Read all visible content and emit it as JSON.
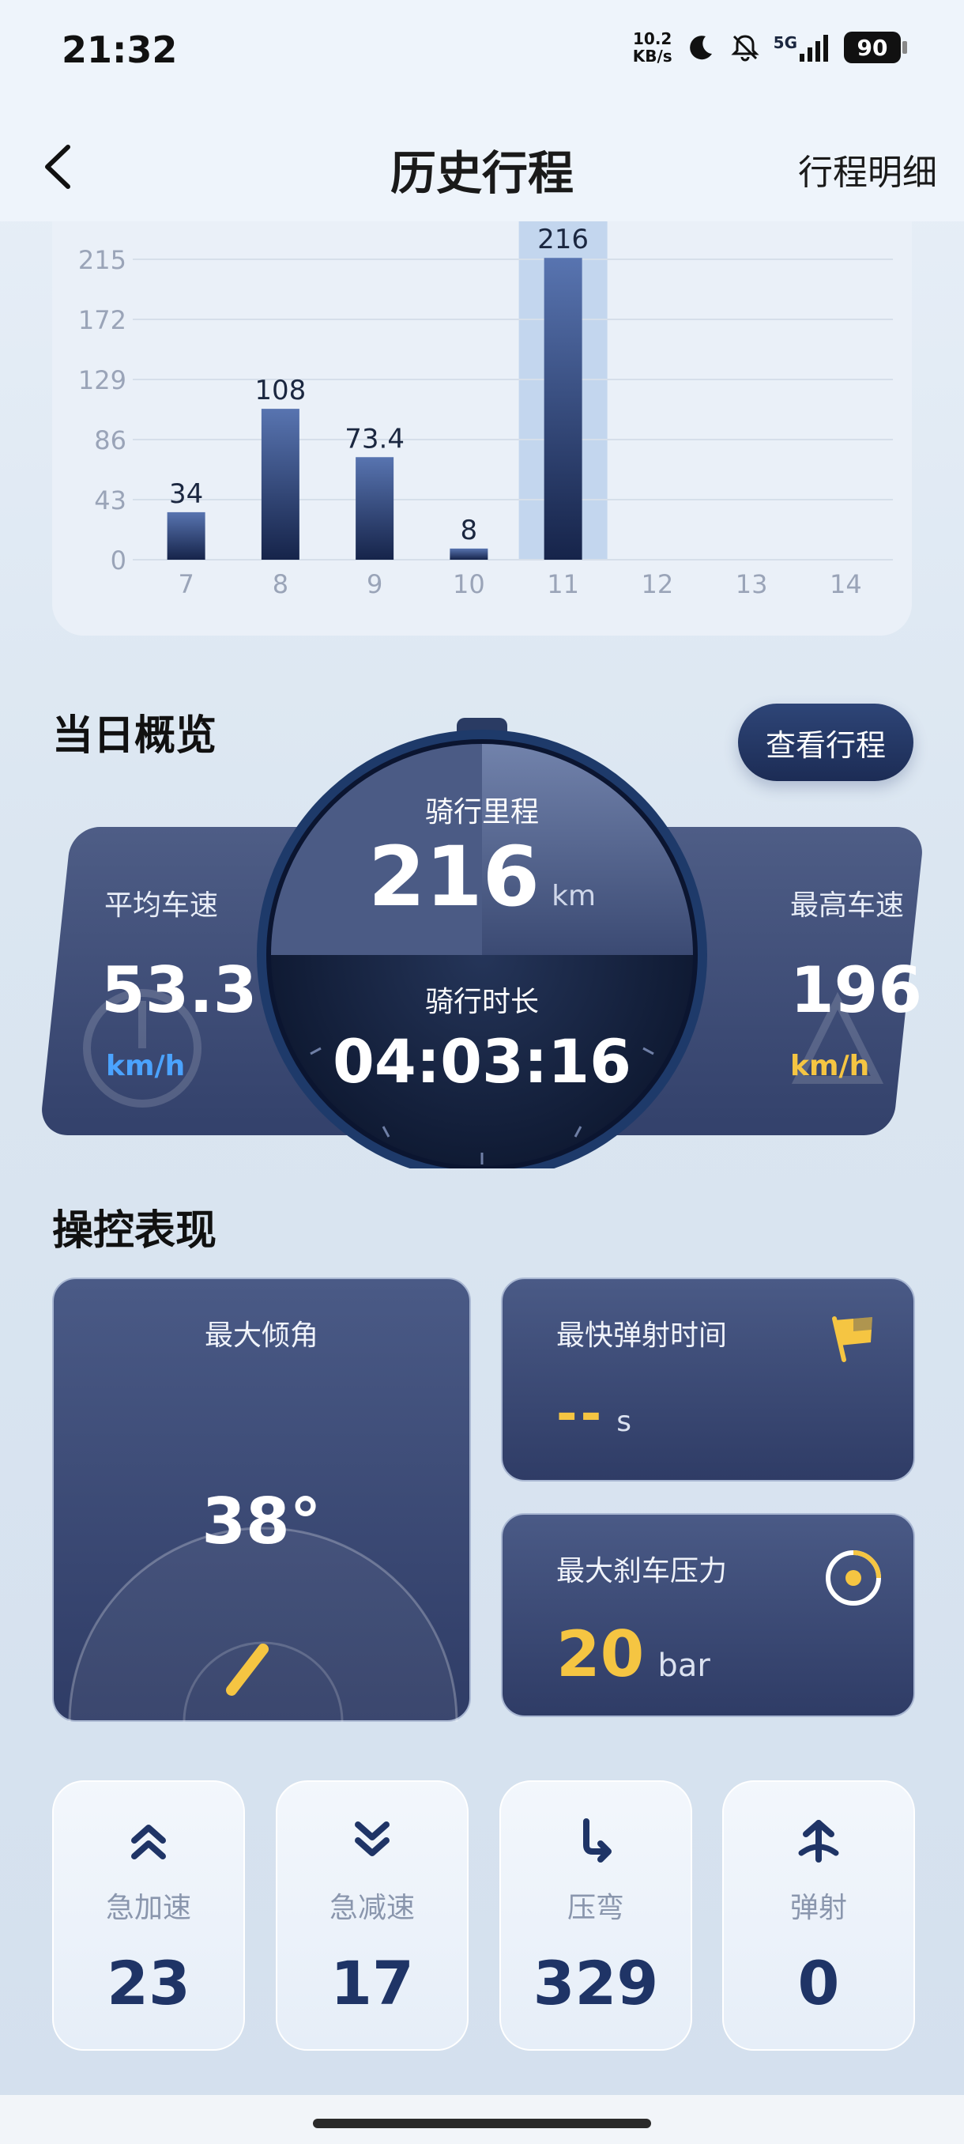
{
  "status_bar": {
    "time": "21:32",
    "net_speed_value": "10.2",
    "net_speed_unit": "KB/s",
    "signal_label": "5G",
    "battery": "90"
  },
  "nav": {
    "title": "历史行程",
    "action": "行程明细"
  },
  "chart_data": {
    "type": "bar",
    "categories": [
      "7",
      "8",
      "9",
      "10",
      "11",
      "12",
      "13",
      "14"
    ],
    "values": [
      34,
      108,
      73.4,
      8,
      216,
      null,
      null,
      null
    ],
    "value_labels": [
      "34",
      "108",
      "73.4",
      "8",
      "216",
      "",
      "",
      ""
    ],
    "yticks": [
      "0",
      "43",
      "86",
      "129",
      "172",
      "215"
    ],
    "ylim": [
      0,
      215
    ],
    "selected_index": 4,
    "grid": true
  },
  "overview": {
    "title": "当日概览",
    "view_button": "查看行程",
    "avg_speed_label": "平均车速",
    "avg_speed_value": "53.3",
    "avg_speed_unit": "km/h",
    "distance_label": "骑行里程",
    "distance_value": "216",
    "distance_unit": "km",
    "duration_label": "骑行时长",
    "duration_value": "04:03:16",
    "max_speed_label": "最高车速",
    "max_speed_value": "196",
    "max_speed_unit": "km/h"
  },
  "control": {
    "title": "操控表现",
    "lean_label": "最大倾角",
    "lean_value": "38°",
    "launch_label": "最快弹射时间",
    "launch_value": "--",
    "launch_unit": "s",
    "brake_label": "最大刹车压力",
    "brake_value": "20",
    "brake_unit": "bar"
  },
  "tiles": [
    {
      "label": "急加速",
      "value": "23",
      "icon": "double-chevron-up-icon"
    },
    {
      "label": "急减速",
      "value": "17",
      "icon": "double-chevron-down-icon"
    },
    {
      "label": "压弯",
      "value": "329",
      "icon": "turn-arrow-icon"
    },
    {
      "label": "弹射",
      "value": "0",
      "icon": "launch-arrow-icon"
    }
  ],
  "colors": {
    "accent_blue": "#4ba3ff",
    "accent_yellow": "#f5c542",
    "dark_navy": "#1f3466"
  }
}
